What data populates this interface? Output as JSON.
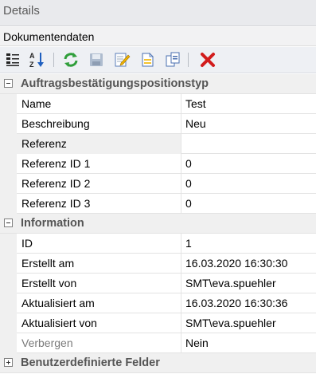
{
  "window": {
    "title": "Details"
  },
  "section": {
    "title": "Dokumentendaten"
  },
  "toolbar": {
    "buttons": [
      {
        "icon": "categorized-icon"
      },
      {
        "icon": "sort-alphabetical-icon"
      },
      {
        "icon": "refresh-icon"
      },
      {
        "icon": "save-icon"
      },
      {
        "icon": "edit-icon"
      },
      {
        "icon": "document-icon"
      },
      {
        "icon": "copy-icon"
      },
      {
        "icon": "delete-icon"
      }
    ]
  },
  "categories": [
    {
      "label": "Auftragsbestätigungspositionstyp",
      "expanded": true,
      "rows": [
        {
          "name": "Name",
          "value": "Test"
        },
        {
          "name": "Beschreibung",
          "value": "Neu"
        },
        {
          "name": "Referenz",
          "value": ""
        },
        {
          "name": "Referenz ID 1",
          "value": "0"
        },
        {
          "name": "Referenz ID 2",
          "value": "0"
        },
        {
          "name": "Referenz ID 3",
          "value": "0"
        }
      ]
    },
    {
      "label": "Information",
      "expanded": true,
      "rows": [
        {
          "name": "ID",
          "value": "1"
        },
        {
          "name": "Erstellt am",
          "value": "16.03.2020 16:30:30"
        },
        {
          "name": "Erstellt von",
          "value": "SMT\\eva.spuehler"
        },
        {
          "name": "Aktualisiert am",
          "value": "16.03.2020 16:30:36"
        },
        {
          "name": "Aktualisiert von",
          "value": "SMT\\eva.spuehler"
        },
        {
          "name": "Verbergen",
          "value": "Nein"
        }
      ]
    },
    {
      "label": "Benutzerdefinierte Felder",
      "expanded": false,
      "rows": []
    }
  ]
}
